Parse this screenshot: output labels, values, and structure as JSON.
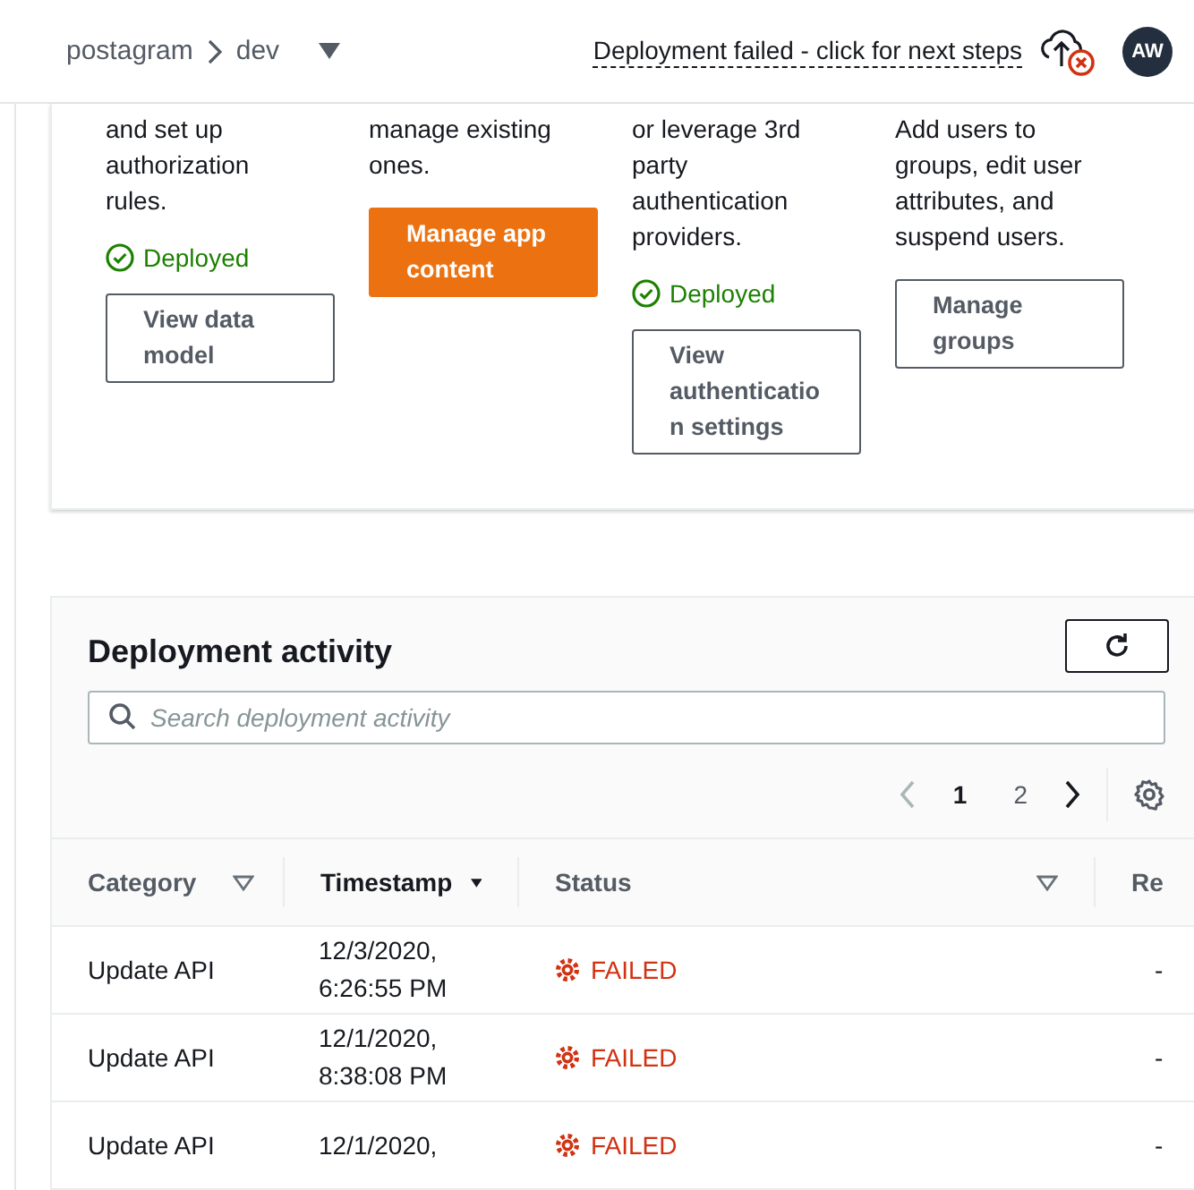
{
  "header": {
    "breadcrumb": [
      "postagram",
      "dev"
    ],
    "notice": "Deployment failed - click for next steps",
    "avatar": "AW"
  },
  "features": [
    {
      "description": "and set up authorization rules.",
      "status": {
        "kind": "success",
        "label": "Deployed"
      },
      "button": {
        "label": "View data model",
        "kind": "normal"
      }
    },
    {
      "description": "manage existing ones.",
      "button": {
        "label": "Manage app content",
        "kind": "primary"
      }
    },
    {
      "description": "or leverage 3rd party authentication providers.",
      "status": {
        "kind": "success",
        "label": "Deployed"
      },
      "button": {
        "label": "View authentication settings",
        "kind": "normal"
      }
    },
    {
      "description": "Add users to groups, edit user attributes, and suspend users.",
      "button": {
        "label": "Manage groups",
        "kind": "normal"
      }
    }
  ],
  "activity": {
    "title": "Deployment activity",
    "search": {
      "placeholder": "Search deployment activity"
    },
    "pages": [
      {
        "label": "1",
        "selected": true
      },
      {
        "label": "2",
        "selected": false
      }
    ],
    "columns": [
      {
        "label": "Category",
        "kind": "filter"
      },
      {
        "label": "Timestamp",
        "kind": "sorted"
      },
      {
        "label": "Status",
        "kind": "filter"
      },
      {
        "label": "Re",
        "kind": "plain"
      }
    ],
    "rows": [
      {
        "category": "Update API",
        "timestamp": [
          "12/3/2020,",
          "6:26:55 PM"
        ],
        "status": {
          "kind": "failed",
          "label": "FAILED"
        },
        "column_4": "-"
      },
      {
        "category": "Update API",
        "timestamp": [
          "12/1/2020,",
          "8:38:08 PM"
        ],
        "status": {
          "kind": "failed",
          "label": "FAILED"
        },
        "column_4": "-"
      },
      {
        "category": "Update API",
        "timestamp": [
          "12/1/2020,"
        ],
        "status": {
          "kind": "failed",
          "label": "FAILED"
        },
        "column_4": "-"
      }
    ]
  }
}
